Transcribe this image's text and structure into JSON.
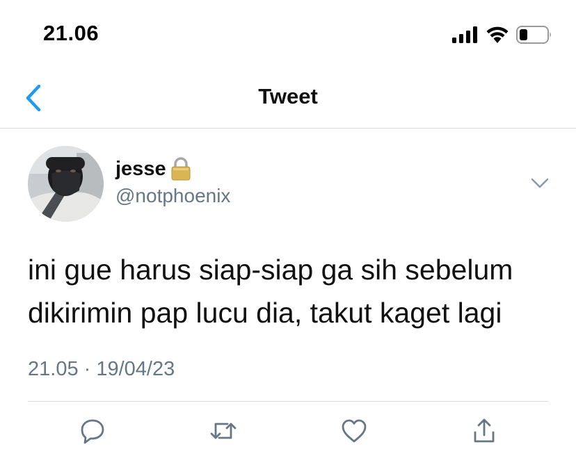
{
  "status_bar": {
    "time": "21.06",
    "icons": [
      "signal-icon",
      "wifi-icon",
      "battery-icon"
    ]
  },
  "nav": {
    "title": "Tweet",
    "back_icon": "chevron-left-icon"
  },
  "tweet": {
    "display_name": "jesse",
    "handle": "@notphoenix",
    "protected_icon": "lock-icon",
    "text": "ini gue harus siap-siap ga sih sebelum dikirimin pap lucu dia, takut kaget lagi",
    "time": "21.05",
    "date": "19/04/23",
    "separator": " · "
  },
  "actions": [
    "reply-icon",
    "retweet-icon",
    "like-icon",
    "share-icon"
  ],
  "colors": {
    "accent": "#1d9bf0",
    "secondary_text": "#657786",
    "divider": "#d6dade",
    "lock_gold": "#d9b556"
  }
}
